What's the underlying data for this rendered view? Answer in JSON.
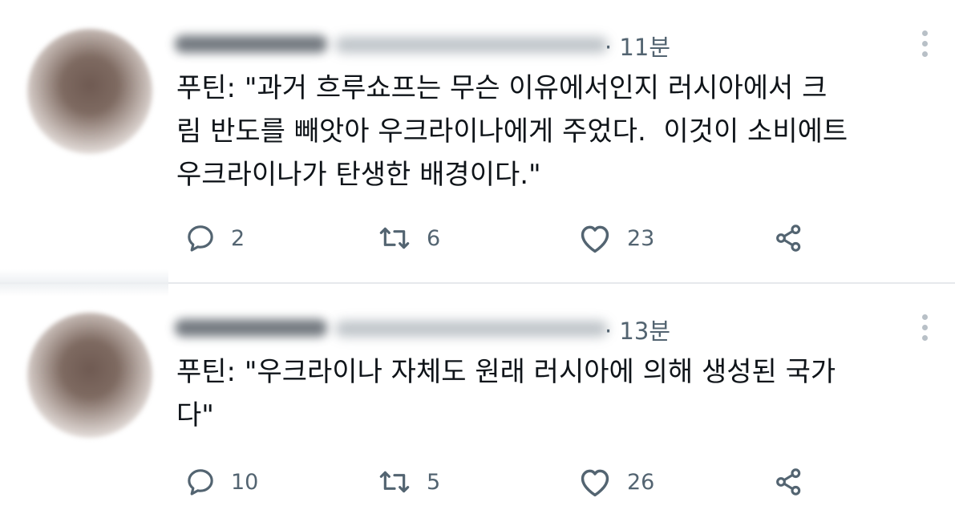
{
  "tweets": [
    {
      "time": "· 11분",
      "text": "푸틴: \"과거 흐루쇼프는 무슨 이유에서인지 러시아에서 크\n림 반도를 빼앗아 우크라이나에게 주었다.  이것이 소비에트\n우크라이나가 탄생한 배경이다.\"",
      "replies": "2",
      "retweets": "6",
      "likes": "23"
    },
    {
      "time": "· 13분",
      "text": "푸틴: \"우크라이나 자체도 원래 러시아에 의해 생성된 국가\n다\"",
      "replies": "10",
      "retweets": "5",
      "likes": "26"
    }
  ],
  "icons": {
    "reply": "reply-icon",
    "retweet": "retweet-icon",
    "like": "heart-icon",
    "share": "share-icon",
    "more": "more-options-icon"
  },
  "colors": {
    "text": "#0f1419",
    "muted": "#536471",
    "divider": "#e6e9ec"
  }
}
